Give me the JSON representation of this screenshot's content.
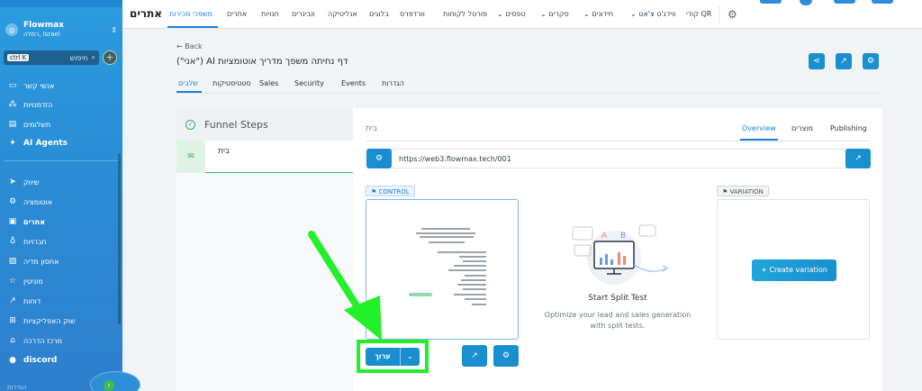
{
  "sidebar": {
    "workspace_name": "Flowmax",
    "workspace_sub": "רמלה, Israel",
    "search_placeholder": "חיפוש",
    "search_shortcut": "ctrl K",
    "items": [
      {
        "label": "אנשי קשר",
        "icon": "contact-card-icon"
      },
      {
        "label": "הזדמנויות",
        "icon": "grid-icon"
      },
      {
        "label": "תשלומים",
        "icon": "receipt-icon"
      },
      {
        "label": "AI Agents",
        "icon": "sparkle-icon"
      },
      {
        "label": "שיווק",
        "icon": "send-icon"
      },
      {
        "label": "אוטומציה",
        "icon": "automation-icon"
      },
      {
        "label": "אתרים",
        "icon": "globe-icon"
      },
      {
        "label": "חברויות",
        "icon": "badge-icon"
      },
      {
        "label": "אחסון מדיה",
        "icon": "image-icon"
      },
      {
        "label": "מוניטין",
        "icon": "star-icon"
      },
      {
        "label": "דוחות",
        "icon": "trend-icon"
      },
      {
        "label": "שוק האפליקציות",
        "icon": "apps-icon"
      },
      {
        "label": "מרכז הדרכה",
        "icon": "graduation-icon"
      },
      {
        "label": "discord",
        "icon": "discord-icon"
      }
    ],
    "bottom_label": "הגדרות"
  },
  "topnav": {
    "title": "אתרים",
    "items": [
      "משפכי מכירות",
      "אתרים",
      "חנויות",
      "וובינרים",
      "אנליטיקה",
      "בלוגים",
      "וורדפרס",
      "פורטל לקוחות",
      "טפסים",
      "סקרים",
      "חידונים",
      "ווידג'ט צ'אט",
      "קודי QR"
    ]
  },
  "header": {
    "back_label": "← Back",
    "page_title": "(\"אני\") AI דף נחיתה משפך מדריך אוטומציות",
    "tabs": [
      "שלבים",
      "סטטיסטיקות",
      "Sales",
      "Security",
      "Events",
      "הגדרות"
    ]
  },
  "funnel": {
    "panel_title": "Funnel Steps",
    "steps": [
      {
        "label": "בית"
      }
    ]
  },
  "main": {
    "breadcrumb": "בית",
    "tabs": [
      "Overview",
      "מוצרים",
      "Publishing"
    ],
    "url": "https://web3.flowmax.tech/001",
    "control_tag": "CONTROL",
    "variation_tag": "VARIATION",
    "create_variation": "+ Create variation",
    "split_test_title": "Start Split Test",
    "split_test_desc_1": "Optimize your lead and sales generation",
    "split_test_desc_2": "with split tests.",
    "edit_label": "ערוך"
  },
  "colors": {
    "accent": "#1d7fd6",
    "success": "#3bb55e",
    "highlight": "#22f02a"
  }
}
